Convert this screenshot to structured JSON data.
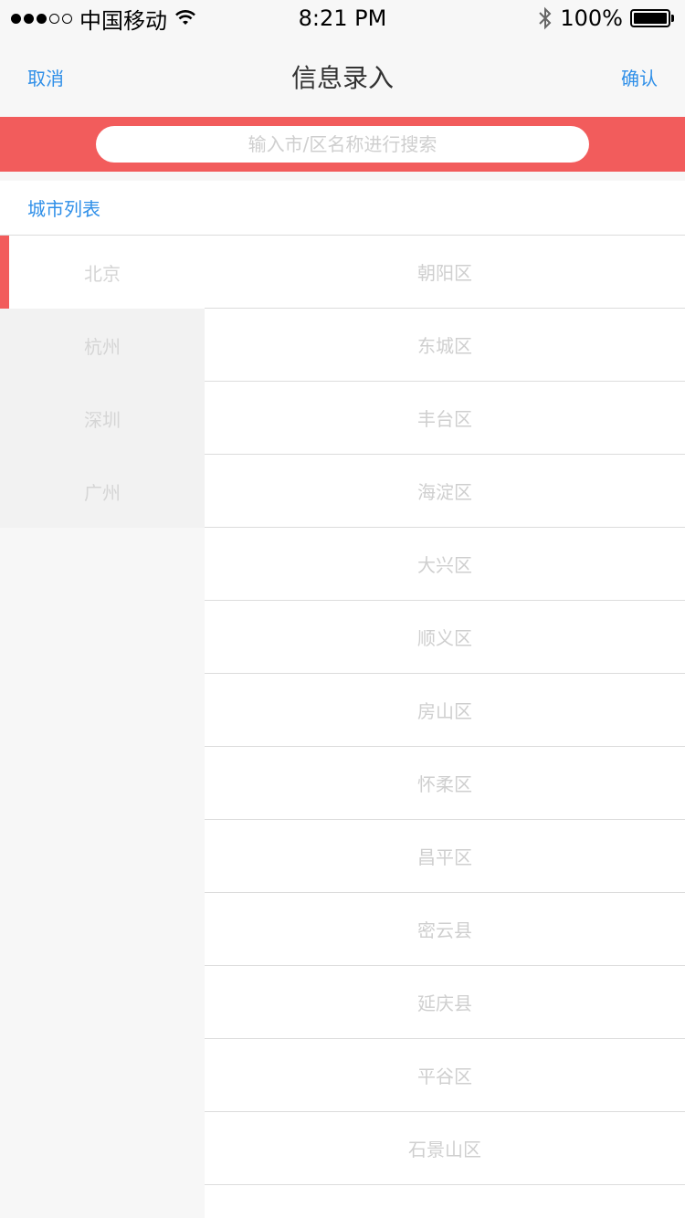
{
  "status_bar": {
    "carrier": "中国移动",
    "time": "8:21 PM",
    "battery": "100%",
    "signal_dots_filled": 3,
    "signal_dots_total": 5
  },
  "nav": {
    "left": "取消",
    "title": "信息录入",
    "right": "确认"
  },
  "search": {
    "placeholder": "输入市/区名称进行搜索"
  },
  "section": {
    "title": "城市列表"
  },
  "cities": [
    {
      "label": "北京"
    },
    {
      "label": "杭州"
    },
    {
      "label": "深圳"
    },
    {
      "label": "广州"
    }
  ],
  "districts": [
    {
      "label": "朝阳区"
    },
    {
      "label": "东城区"
    },
    {
      "label": "丰台区"
    },
    {
      "label": "海淀区"
    },
    {
      "label": "大兴区"
    },
    {
      "label": "顺义区"
    },
    {
      "label": "房山区"
    },
    {
      "label": "怀柔区"
    },
    {
      "label": "昌平区"
    },
    {
      "label": "密云县"
    },
    {
      "label": "延庆县"
    },
    {
      "label": "平谷区"
    },
    {
      "label": "石景山区"
    },
    {
      "label": ""
    }
  ],
  "colors": {
    "accent": "#f25c5c",
    "link": "#2f8fe8"
  }
}
